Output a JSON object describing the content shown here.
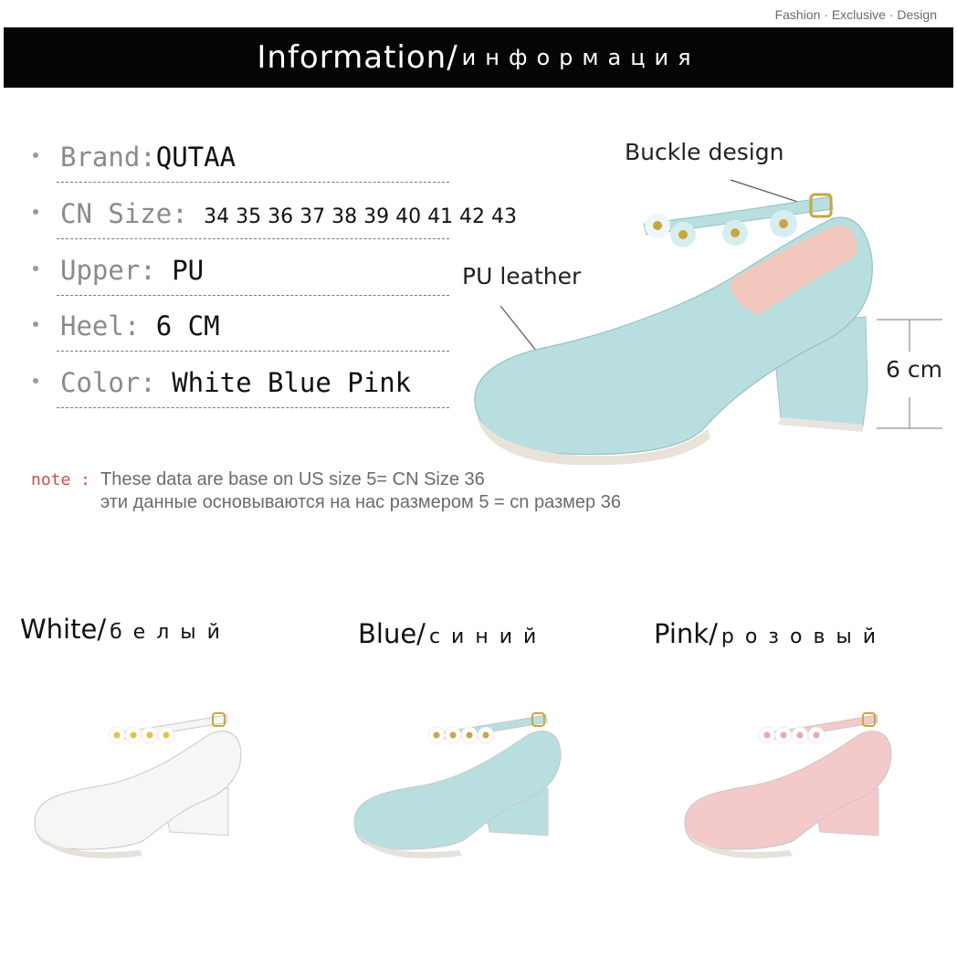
{
  "tagline": "Fashion  · Exclusive  · Design",
  "header": {
    "title": "Information/",
    "subtitle": "информация"
  },
  "specs": [
    {
      "label": "Brand:",
      "value": "QUTAA"
    },
    {
      "label": "CN Size:",
      "value": "34 35 36 37 38 39 40 41 42 43"
    },
    {
      "label": "Upper: ",
      "value": "PU"
    },
    {
      "label": "Heel: ",
      "value": " 6 CM"
    },
    {
      "label": "Color:",
      "value": " White  Blue  Pink"
    }
  ],
  "note": {
    "label": "note :",
    "line1": "These data are base on US size 5= CN Size 36",
    "line2": "эти данные основываются на нас размером 5 = cn размер 36"
  },
  "annotations": {
    "buckle": "Buckle design",
    "leather": "PU leather",
    "heel_height": "6 cm"
  },
  "colors": [
    {
      "name": "White/",
      "ru": "белый",
      "shoe_color": "#f6f6f4",
      "flower_center": "#e3c14a"
    },
    {
      "name": "Blue/",
      "ru": "синий",
      "shoe_color": "#b9dedf",
      "flower_center": "#c9a640"
    },
    {
      "name": "Pink/",
      "ru": "розовый",
      "shoe_color": "#f3c9c9",
      "flower_center": "#e9a9a9"
    }
  ],
  "main_shoe_color": "#b9dedf"
}
